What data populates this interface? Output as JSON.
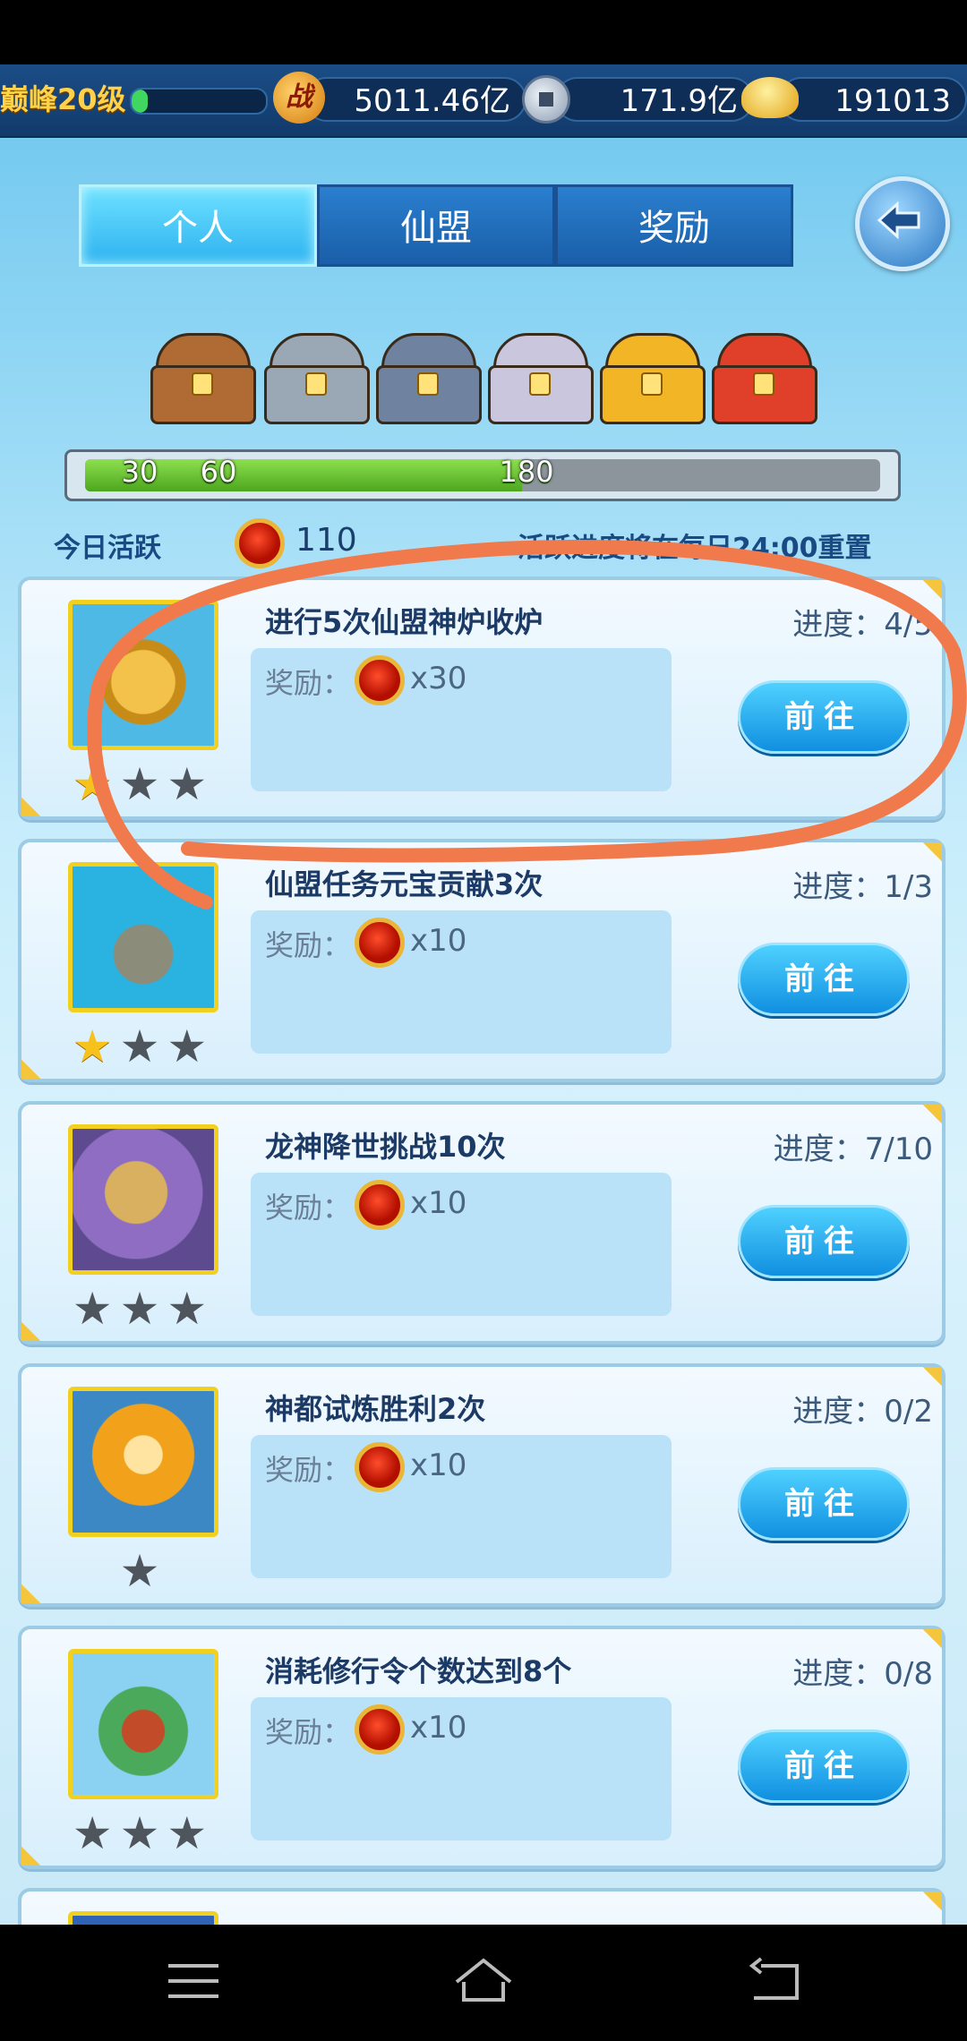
{
  "header": {
    "level_text": "巅峰20级",
    "exp_fraction": 0.12,
    "battle_power": "5011.46亿",
    "battle_icon_text": "战",
    "silver": "171.9亿",
    "gold": "191013"
  },
  "tabs": [
    {
      "label": "个人",
      "active": true
    },
    {
      "label": "仙盟",
      "active": false
    },
    {
      "label": "奖励",
      "active": false
    }
  ],
  "chests": [
    {
      "kind": "wood",
      "color": "#b06b34"
    },
    {
      "kind": "iron",
      "color": "#9aa7b5"
    },
    {
      "kind": "steel",
      "color": "#6f82a0"
    },
    {
      "kind": "silver",
      "color": "#c9c6dd"
    },
    {
      "kind": "gold",
      "color": "#f1b526"
    },
    {
      "kind": "royal",
      "color": "#e0402a"
    }
  ],
  "activity_progress": {
    "fraction": 0.55,
    "milestones": [
      "30",
      "60",
      "",
      "",
      "",
      "180"
    ]
  },
  "activity": {
    "label": "今日活跃",
    "value": "110",
    "reset_note": "活跃进度将在每日24:00重置"
  },
  "tasks": [
    {
      "title": "进行5次仙盟神炉收炉",
      "reward_label": "奖励：",
      "reward_value": "x30",
      "progress": "进度：4/5",
      "button": "前往",
      "stars": 1,
      "max_stars": 3
    },
    {
      "title": "仙盟任务元宝贡献3次",
      "reward_label": "奖励：",
      "reward_value": "x10",
      "progress": "进度：1/3",
      "button": "前往",
      "stars": 1,
      "max_stars": 3
    },
    {
      "title": "龙神降世挑战10次",
      "reward_label": "奖励：",
      "reward_value": "x10",
      "progress": "进度：7/10",
      "button": "前往",
      "stars": 0,
      "max_stars": 3
    },
    {
      "title": "神都试炼胜利2次",
      "reward_label": "奖励：",
      "reward_value": "x10",
      "progress": "进度：0/2",
      "button": "前往",
      "stars": 0,
      "max_stars": 1
    },
    {
      "title": "消耗修行令个数达到8个",
      "reward_label": "奖励：",
      "reward_value": "x10",
      "progress": "进度：0/8",
      "button": "前往",
      "stars": 0,
      "max_stars": 3
    }
  ],
  "colors": {
    "annotation_stroke": "#f07a4c",
    "button_blue": "#1a9be6",
    "tab_active": "#3cc3f5"
  },
  "navbar": {
    "icons": [
      "menu-icon",
      "home-icon",
      "back-icon"
    ]
  }
}
